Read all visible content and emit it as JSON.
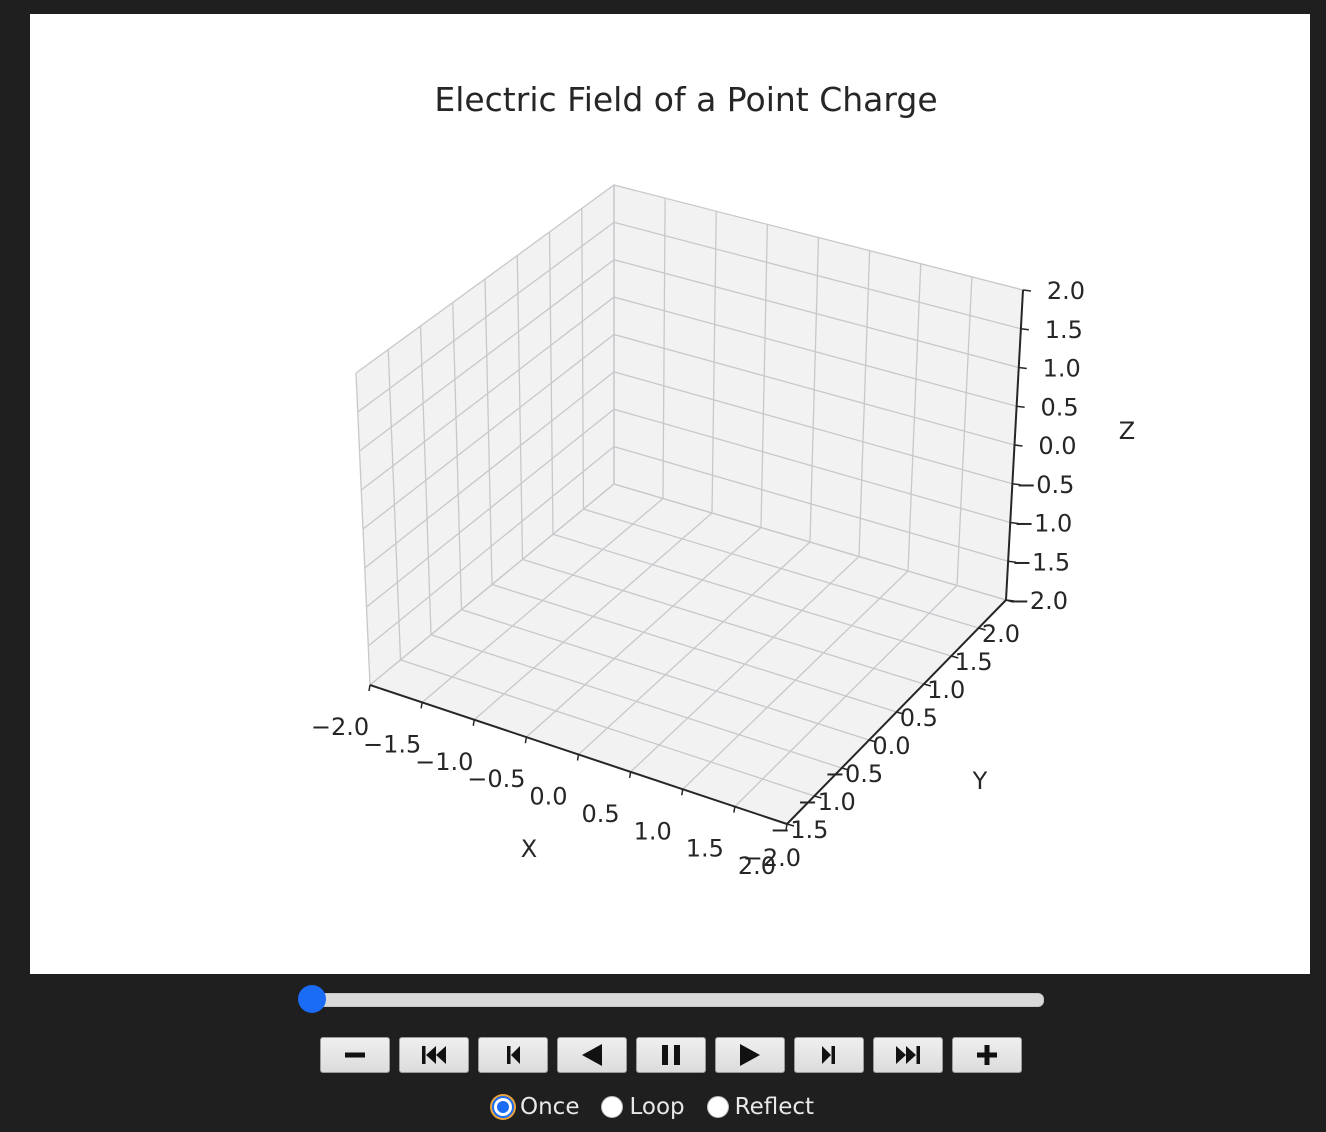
{
  "chart_data": {
    "type": "3d-axes",
    "title": "Electric Field of a Point Charge",
    "xlabel": "X",
    "ylabel": "Y",
    "zlabel": "Z",
    "xlim": [
      -2.0,
      2.0
    ],
    "ylim": [
      -2.0,
      2.0
    ],
    "zlim": [
      -2.0,
      2.0
    ],
    "x_ticks": [
      "−2.0",
      "−1.5",
      "−1.0",
      "−0.5",
      "0.0",
      "0.5",
      "1.0",
      "1.5",
      "2.0"
    ],
    "y_ticks": [
      "−2.0",
      "−1.5",
      "−1.0",
      "−0.5",
      "0.0",
      "0.5",
      "1.0",
      "1.5",
      "2.0"
    ],
    "z_ticks": [
      "−2.0",
      "−1.5",
      "−1.0",
      "−0.5",
      "0.0",
      "0.5",
      "1.0",
      "1.5",
      "2.0"
    ],
    "grid": true,
    "series": []
  },
  "animation": {
    "frame_position": 0,
    "buttons": [
      {
        "name": "decrease-speed-button",
        "icon": "minus-icon"
      },
      {
        "name": "first-frame-button",
        "icon": "skip-to-start-icon"
      },
      {
        "name": "previous-frame-button",
        "icon": "step-back-icon"
      },
      {
        "name": "play-reverse-button",
        "icon": "play-reverse-icon"
      },
      {
        "name": "pause-button",
        "icon": "pause-icon"
      },
      {
        "name": "play-button",
        "icon": "play-icon"
      },
      {
        "name": "next-frame-button",
        "icon": "step-forward-icon"
      },
      {
        "name": "last-frame-button",
        "icon": "skip-to-end-icon"
      },
      {
        "name": "increase-speed-button",
        "icon": "plus-icon"
      }
    ],
    "modes": {
      "once": "Once",
      "loop": "Loop",
      "reflect": "Reflect",
      "selected": "Once"
    }
  },
  "colors": {
    "accent": "#1a6cf5",
    "pane_fill": "#f2f2f2",
    "grid": "#c8c8cc",
    "axis": "#262626"
  }
}
